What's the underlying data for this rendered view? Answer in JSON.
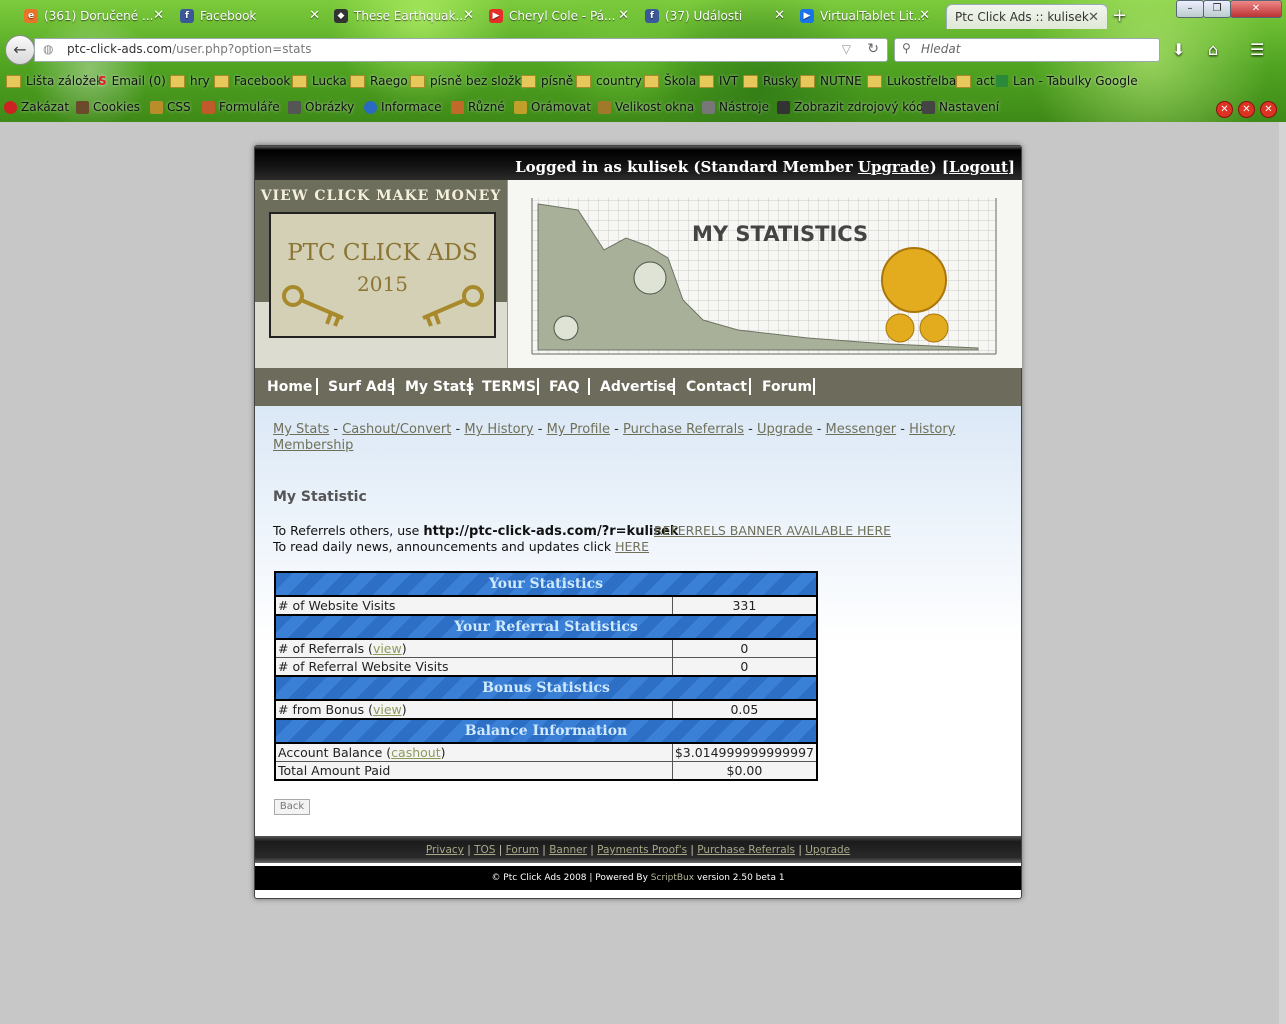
{
  "browser": {
    "tabs": [
      {
        "title": "(361) Doručené ...",
        "icon": "mail-icon",
        "color": "#e8732a"
      },
      {
        "title": "Facebook",
        "icon": "facebook-icon",
        "color": "#3b5998"
      },
      {
        "title": "These Earthquak...",
        "icon": "page-icon",
        "color": "#333333"
      },
      {
        "title": "Cheryl Cole - Pá...",
        "icon": "youtube-icon",
        "color": "#e52d27"
      },
      {
        "title": "(37) Události",
        "icon": "facebook-icon",
        "color": "#3b5998"
      },
      {
        "title": "VirtualTablet Lit...",
        "icon": "play-icon",
        "color": "#1a73e8"
      },
      {
        "title": "Ptc Click Ads :: kulisek",
        "icon": "page-icon",
        "color": "#888888",
        "active": true
      }
    ],
    "url_host": "ptc-click-ads.com",
    "url_path": "/user.php?option=stats",
    "search_placeholder": "Hledat",
    "bookmarks": [
      "Lišta záložek",
      "Email (0)",
      "hry",
      "Facebook",
      "Lucka",
      "Raego",
      "písně bez složky",
      "písně",
      "country",
      "Škola",
      "IVT",
      "Rusky",
      "NUTNE",
      "Lukostřelba",
      "act",
      "Lan - Tabulky Google"
    ],
    "devtools": [
      "Zakázat",
      "Cookies",
      "CSS",
      "Formuláře",
      "Obrázky",
      "Informace",
      "Různé",
      "Orámovat",
      "Velikost okna",
      "Nástroje",
      "Zobrazit zdrojový kód",
      "Nastavení"
    ]
  },
  "site": {
    "login_text": "Logged in as kulisek (Standard Member ",
    "upgrade_link": "Upgrade",
    "login_mid": ") [",
    "logout_link": "Logout",
    "login_end": "]",
    "logo_tagline": "VIEW CLICK MAKE  MONEY",
    "logo_line1": "PTC CLICK ADS",
    "logo_line2": "2015",
    "banner_title": "MY STATISTICS",
    "menu": [
      "Home",
      "Surf Ads",
      "My Stats",
      "TERMS",
      "FAQ",
      "Advertise",
      "Contact",
      "Forum"
    ],
    "sublinks": [
      "My Stats",
      "Cashout/Convert",
      "My History",
      "My Profile",
      "Purchase Referrals",
      "Upgrade",
      "Messenger",
      "History",
      "Membership"
    ],
    "heading": "My Statistic",
    "ref_prefix": "To Referrels others, use ",
    "ref_url": "http://ptc-click-ads.com/?r=kulisek",
    "ref_banner": "REFERRELS BANNER AVAILABLE HERE",
    "news_prefix": "To read daily news, announcements and updates click ",
    "news_link": "HERE",
    "sections": {
      "your_stats": "Your Statistics",
      "referral_stats": "Your Referral Statistics",
      "bonus_stats": "Bonus Statistics",
      "balance": "Balance Information"
    },
    "rows": {
      "visits_label": "# of Website Visits",
      "visits_value": "331",
      "referrals_label": "# of Referrals (",
      "referrals_value": "0",
      "ref_visits_label": "# of Referral Website Visits",
      "ref_visits_value": "0",
      "bonus_label": "# from Bonus (",
      "bonus_value": "0.05",
      "balance_label": "Account Balance (",
      "balance_value": "$3.014999999999997",
      "paid_label": "Total Amount Paid",
      "paid_value": "$0.00",
      "view": "view",
      "cashout": "cashout",
      "close_paren": ")"
    },
    "back_button": "Back",
    "footer_links": [
      "Privacy",
      "TOS",
      "Forum",
      "Banner",
      "Payments Proof's",
      "Purchase Referrals",
      "Upgrade"
    ],
    "copyright": "© Ptc Click Ads 2008 | Powered By ",
    "scriptbux": "ScriptBux",
    "version": " version 2.50 beta 1"
  }
}
